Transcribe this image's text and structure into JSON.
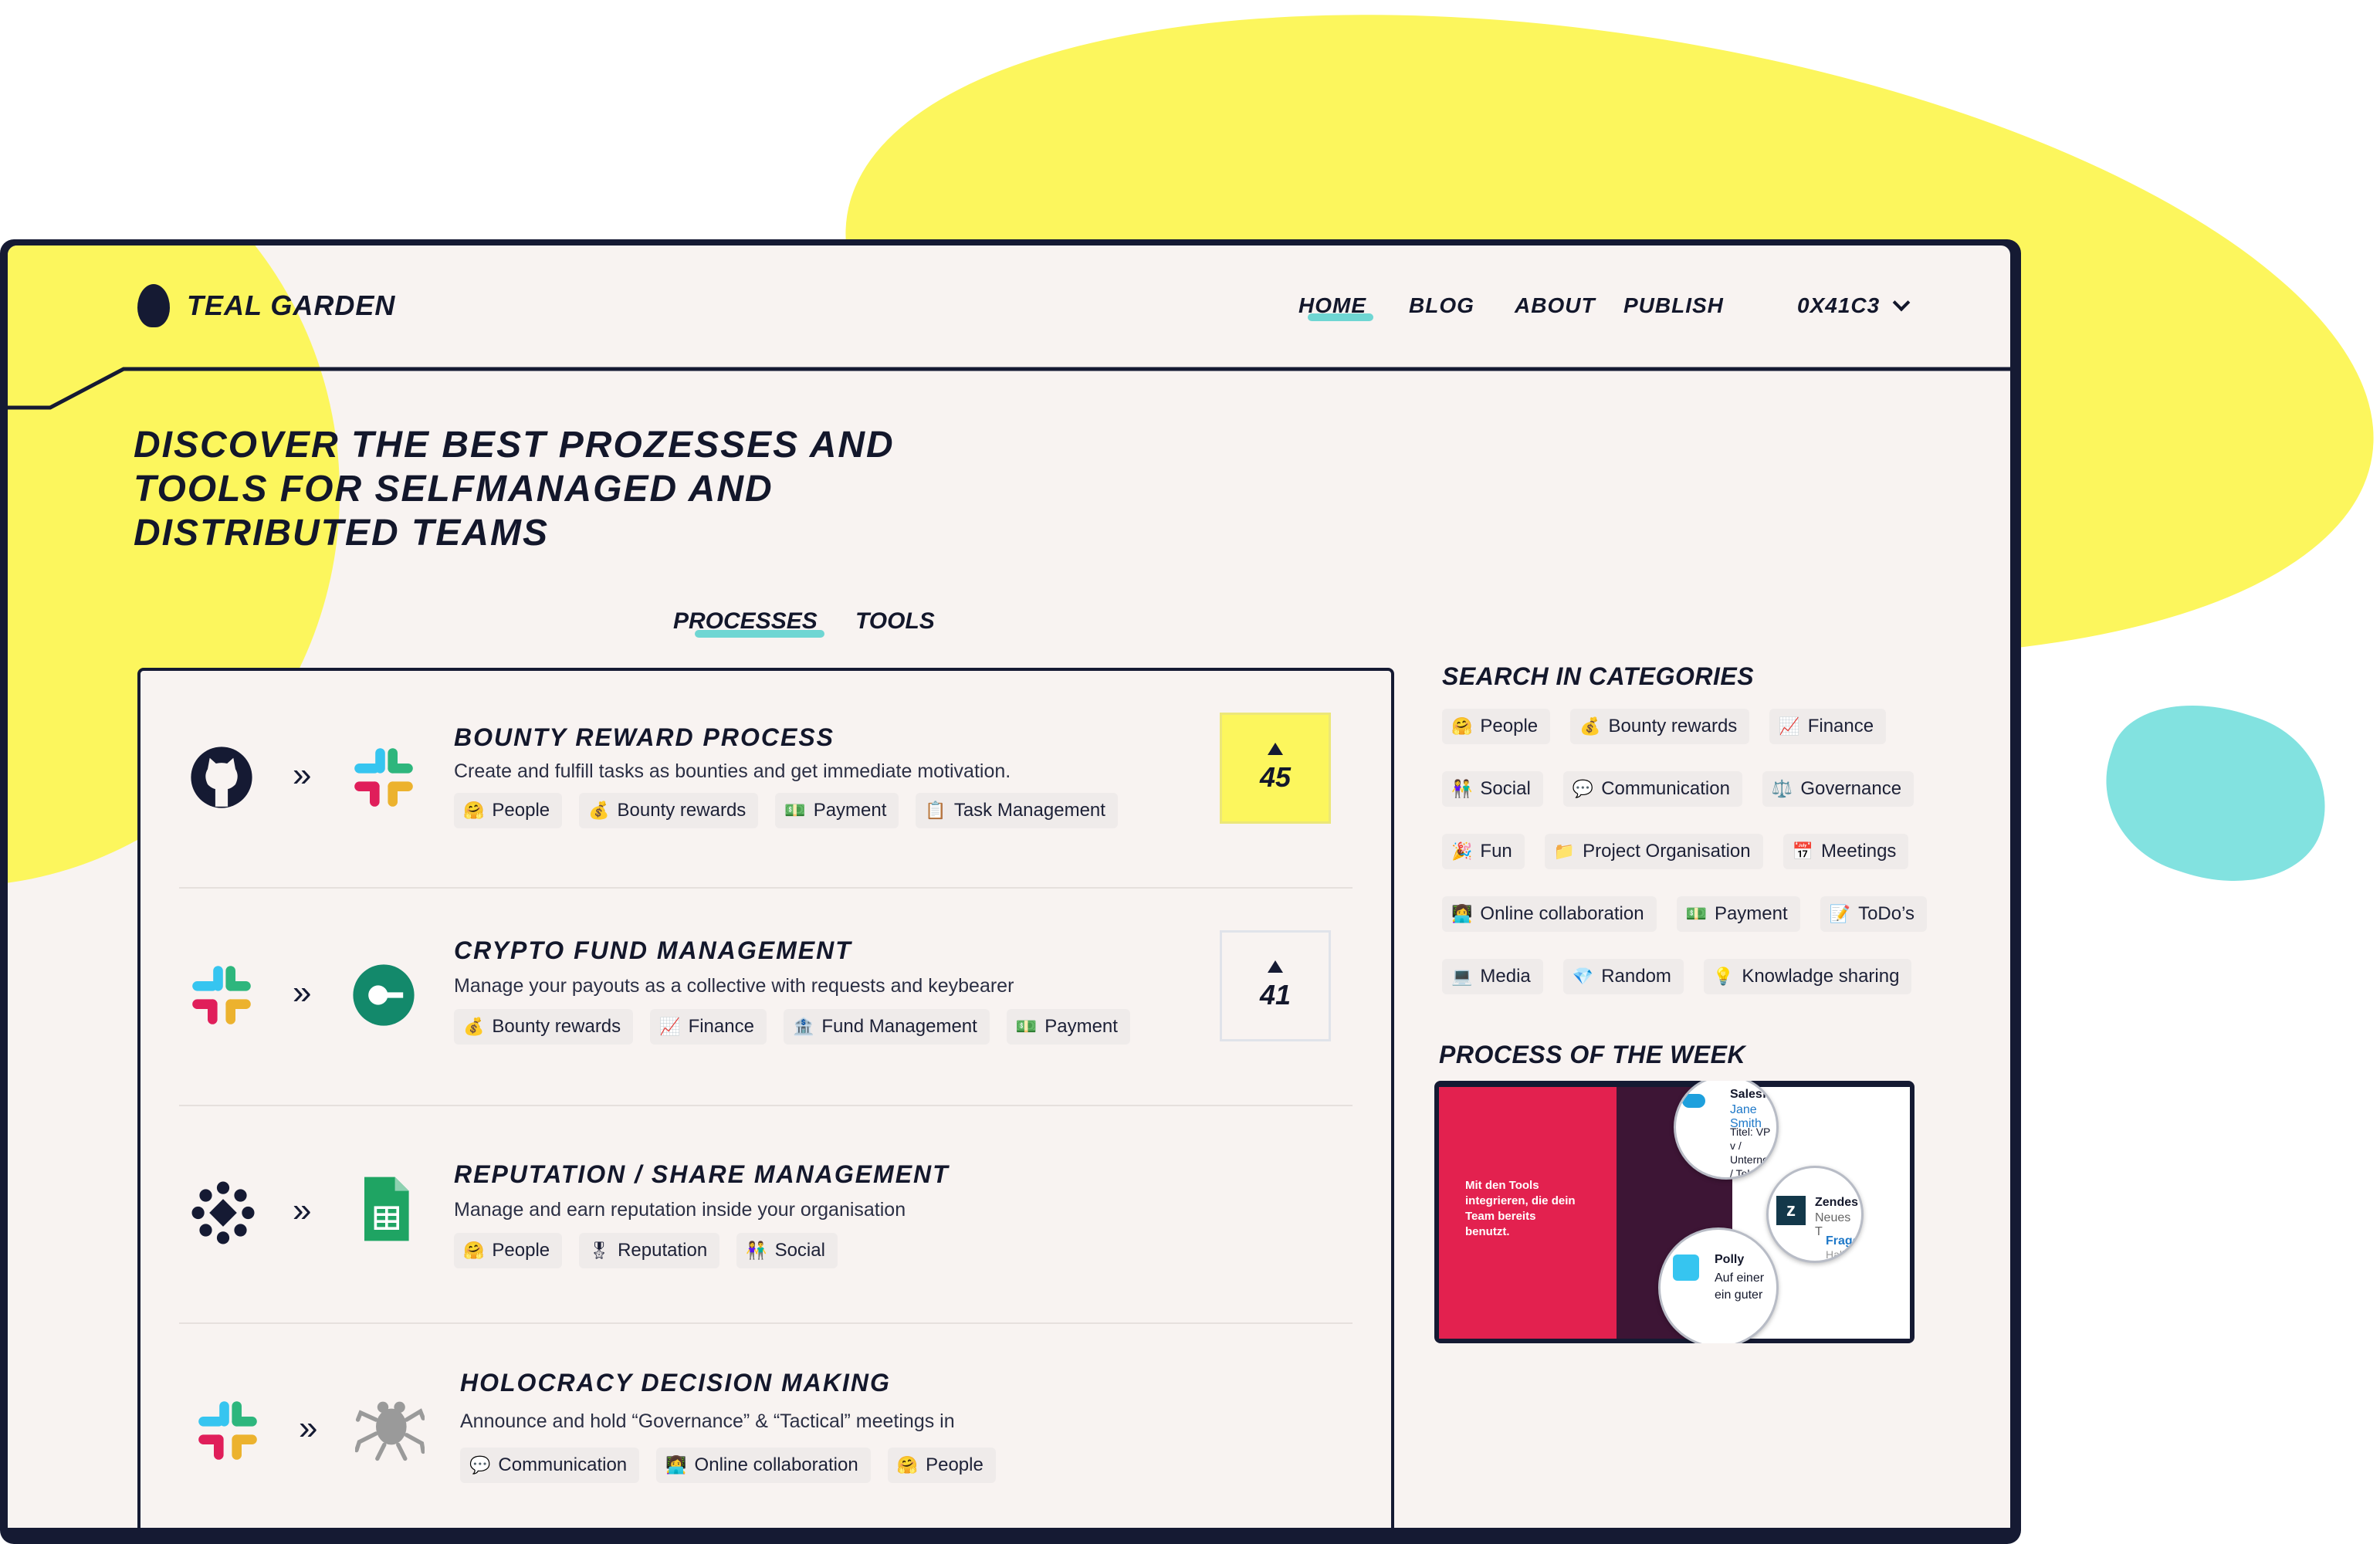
{
  "brand": {
    "name": "TEAL GARDEN"
  },
  "nav": {
    "home": "HOME",
    "blog": "BLOG",
    "about": "ABOUT",
    "publish": "PUBLISH",
    "account": "0X41C3"
  },
  "hero": {
    "title": "DISCOVER THE BEST PROZESSES AND TOOLS FOR SELFMANAGED AND DISTRIBUTED TEAMS"
  },
  "tabs": {
    "processes": "PROCESSES",
    "tools": "TOOLS"
  },
  "processes": [
    {
      "title": "BOUNTY REWARD PROCESS",
      "description": "Create and fulfill tasks as bounties and get immediate motivation.",
      "icons": [
        "github-icon",
        "slack-icon"
      ],
      "votes": "45",
      "voted": true,
      "tags": [
        {
          "emoji": "🤗",
          "label": "People"
        },
        {
          "emoji": "💰",
          "label": "Bounty rewards"
        },
        {
          "emoji": "💵",
          "label": "Payment"
        },
        {
          "emoji": "📋",
          "label": "Task Management"
        }
      ]
    },
    {
      "title": "CRYPTO FUND MANAGEMENT",
      "description": "Manage your payouts as a collective with requests and keybearer",
      "icons": [
        "slack-icon",
        "keybearer-icon"
      ],
      "votes": "41",
      "voted": false,
      "tags": [
        {
          "emoji": "💰",
          "label": "Bounty rewards"
        },
        {
          "emoji": "📈",
          "label": "Finance"
        },
        {
          "emoji": "🏦",
          "label": "Fund Management"
        },
        {
          "emoji": "💵",
          "label": "Payment"
        }
      ]
    },
    {
      "title": "REPUTATION / SHARE MANAGEMENT",
      "description": "Manage and earn reputation inside your organisation",
      "icons": [
        "dots-network-icon",
        "google-sheets-icon"
      ],
      "tags": [
        {
          "emoji": "🤗",
          "label": "People"
        },
        {
          "emoji": "🎖",
          "label": "Reputation"
        },
        {
          "emoji": "👫",
          "label": "Social"
        }
      ]
    },
    {
      "title": "HOLOCRACY DECISION MAKING",
      "description": "Announce and hold “Governance” & “Tactical” meetings in",
      "icons": [
        "slack-icon",
        "frog-icon"
      ],
      "tags": [
        {
          "emoji": "💬",
          "label": "Communication"
        },
        {
          "emoji": "👩‍💻",
          "label": "Online collaboration"
        },
        {
          "emoji": "🤗",
          "label": "People"
        }
      ]
    }
  ],
  "sidebar": {
    "categories_heading": "SEARCH IN CATEGORIES",
    "categories": [
      [
        {
          "emoji": "🤗",
          "label": "People"
        },
        {
          "emoji": "💰",
          "label": "Bounty rewards"
        },
        {
          "emoji": "📈",
          "label": "Finance"
        }
      ],
      [
        {
          "emoji": "👫",
          "label": "Social"
        },
        {
          "emoji": "💬",
          "label": "Communication"
        },
        {
          "emoji": "⚖️",
          "label": "Governance"
        }
      ],
      [
        {
          "emoji": "🎉",
          "label": "Fun"
        },
        {
          "emoji": "📁",
          "label": "Project Organisation"
        },
        {
          "emoji": "📅",
          "label": "Meetings"
        }
      ],
      [
        {
          "emoji": "👩‍💻",
          "label": "Online collaboration"
        },
        {
          "emoji": "💵",
          "label": "Payment"
        },
        {
          "emoji": "📝",
          "label": "ToDo’s"
        }
      ],
      [
        {
          "emoji": "💻",
          "label": "Media"
        },
        {
          "emoji": "💎",
          "label": "Random"
        },
        {
          "emoji": "💡",
          "label": "Knowladge sharing"
        }
      ]
    ],
    "potw_heading": "PROCESS OF THE WEEK",
    "potw": {
      "promo_text": "Mit den Tools integrieren, die dein Team bereits benutzt.",
      "bubble_sf_name": "Salesforce",
      "bubble_sf_contact": "Jane Smith",
      "bubble_sf_lines": "Titel: VP v / Unternehm / Telefon / E-Mail",
      "bubble_zd_name": "Zendes",
      "bubble_zd_sub": "Neues T",
      "bubble_zd_q": "Frage",
      "bubble_zd_q2": "Hallo",
      "bubble_polly_name": "Polly",
      "bubble_polly_text": "Auf einer ein guter"
    }
  }
}
